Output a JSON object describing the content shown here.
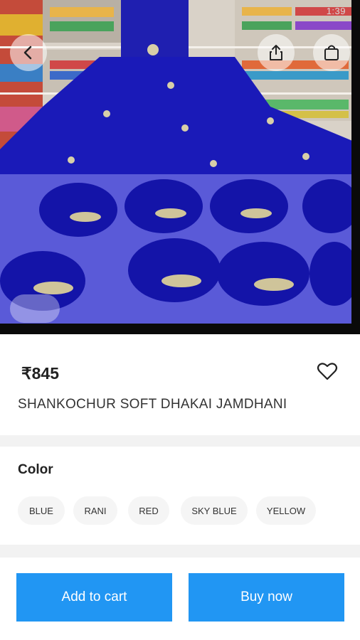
{
  "status": {
    "time": "1:39"
  },
  "product": {
    "price": "₹845",
    "title": "SHANKOCHUR SOFT DHAKAI JAMDHANI"
  },
  "colors": {
    "label": "Color",
    "options": [
      "BLUE",
      "RANI",
      "RED",
      "SKY BLUE",
      "YELLOW"
    ]
  },
  "actions": {
    "add_to_cart": "Add to cart",
    "buy_now": "Buy now"
  },
  "icons": {
    "back": "arrow-left-icon",
    "share": "share-icon",
    "bag": "shopping-bag-icon",
    "favorite": "heart-outline-icon"
  },
  "theme": {
    "accent": "#2196f3",
    "saree_blue": "#1a1ab8"
  }
}
